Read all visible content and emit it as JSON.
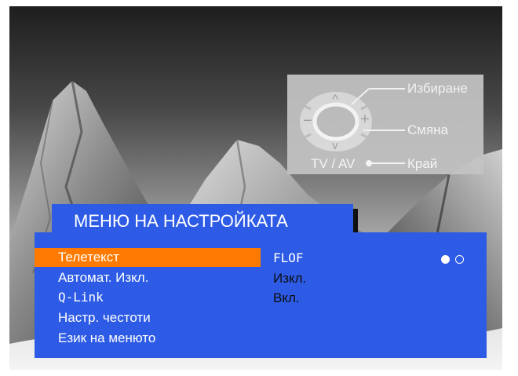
{
  "remote_hint": {
    "arrow_up": "^",
    "arrow_down": "v",
    "minus": "−",
    "plus": "+",
    "tv_av_label": "TV / AV",
    "select_label": "Избиране",
    "change_label": "Смяна",
    "exit_label": "Край"
  },
  "menu": {
    "title": "МЕНЮ НА НАСТРОЙКАТА",
    "items": [
      {
        "label": "Телетекст",
        "value": "FLOF",
        "selected": true
      },
      {
        "label": "Автомат. Изкл.",
        "value": "Изкл.",
        "selected": false
      },
      {
        "label": "Q-Link",
        "value": "Вкл.",
        "selected": false
      },
      {
        "label": "Настр. честоти",
        "value": "",
        "selected": false
      },
      {
        "label": "Език на менюто",
        "value": "",
        "selected": false
      }
    ],
    "option_indicator": {
      "filled": 1,
      "total": 2
    }
  },
  "colors": {
    "menu_blue": "#2d5be6",
    "highlight_orange": "#ff7a00",
    "panel_grey": "#c4c4c4"
  }
}
